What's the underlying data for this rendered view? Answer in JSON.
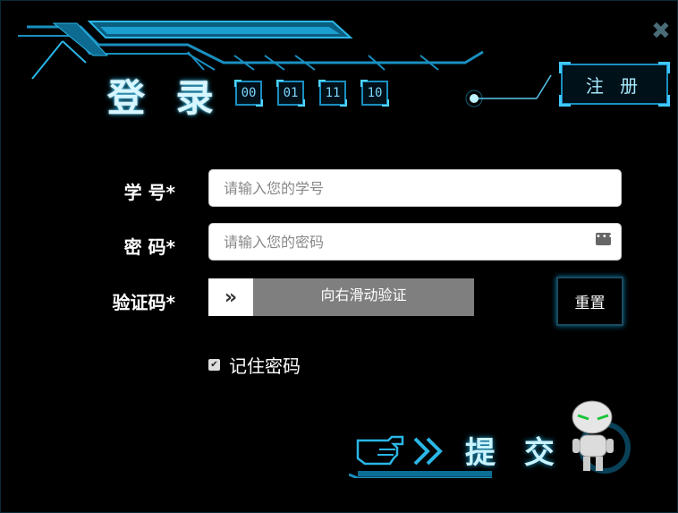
{
  "header": {
    "title": "登 录",
    "codes": [
      "00",
      "01",
      "11",
      "10"
    ],
    "register_label": "注 册",
    "close_symbol": "✖"
  },
  "form": {
    "student_id": {
      "label": "学 号*",
      "placeholder": "请输入您的学号",
      "value": ""
    },
    "password": {
      "label": "密 码*",
      "placeholder": "请输入您的密码",
      "value": ""
    },
    "captcha": {
      "label": "验证码*",
      "handle_symbol": "»",
      "slider_text": "向右滑动验证",
      "reset_label": "重置"
    },
    "remember": {
      "label": "记住密码",
      "checked": true,
      "check_symbol": "✔"
    }
  },
  "submit": {
    "label": "提 交"
  },
  "colors": {
    "accent": "#1a8fc0",
    "glow": "#40c8ff",
    "background": "#000000",
    "slider": "#7f7f7f"
  }
}
